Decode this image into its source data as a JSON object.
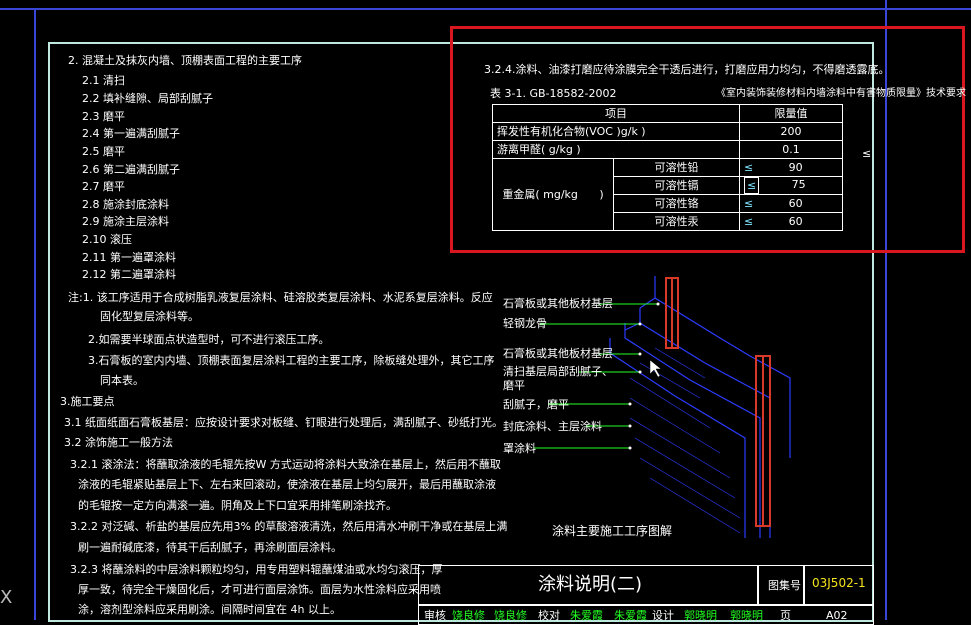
{
  "left_notes": {
    "section2_title": "2. 混凝土及抹灰内墙、顶棚表面工程的主要工序",
    "steps": [
      "2.1 清扫",
      "2.2 填补缝隙、局部刮腻子",
      "2.3 磨平",
      "2.4 第一遍满刮腻子",
      "2.5 磨平",
      "2.6 第二遍满刮腻子",
      "2.7 磨平",
      "2.8 施涂封底涂料",
      "2.9 施涂主层涂料",
      "2.10 滚压",
      "2.11 第一遍罩涂料",
      "2.12 第二遍罩涂料"
    ],
    "note1a": "注:1.  该工序适用于合成树脂乳液复层涂料、硅溶胶类复层涂料、水泥系复层涂料。反应",
    "note1b": "固化型复层涂料等。",
    "note2": "2.如需要半球面点状造型时，可不进行滚压工序。",
    "note3a": "3.石膏板的室内内墙、顶棚表面复层涂料工程的主要工序，除板缝处理外，其它工序",
    "note3b": "同本表。",
    "section3_title": "3.施工要点",
    "p31": "3.1 纸面纸面石膏板基层：应按设计要求对板缝、钉眼进行处理后，满刮腻子、砂纸打光。",
    "p32": "3.2 涂饰施工一般方法",
    "p321a": "3.2.1 滚涂法：将蘸取涂液的毛辊先按W   方式运动将涂料大致涂在基层上，然后用不蘸取",
    "p321b": "涂液的毛辊紧贴基层上下、左右来回滚动，使涂液在基层上均匀展开，最后用蘸取涂液",
    "p321c": "的毛辊按一定方向满滚一遍。阴角及上下口宜采用排笔刷涂找齐。",
    "p322a": "3.2.2 对泛碱、析盐的基层应先用3%     的草酸溶液清洗，然后用清水冲刷干净或在基层上满",
    "p322b": "刷一遍耐碱底漆，待其干后刮腻子，再涂刷面层涂料。",
    "p323a": "3.2.3 将蘸涂料的中层涂料颗粒均匀，用专用塑料辊蘸煤油或水均匀滚压，厚",
    "p323b": "厚一致，待完全干燥固化后，才可进行面层涂饰。面层为水性涂料应采用喷",
    "p323c": "涂，溶剂型涂料应采用刷涂。间隔时间宜在 4h      以上。"
  },
  "highlight_block": {
    "clause": "3.2.4.涂料、油漆打磨应待涂膜完全干透后进行，打磨应用力均匀，不得磨透露底。",
    "table_ref": "表 3-1. GB-18582-2002",
    "table_title": "《室内装饰装修材料内墙涂料中有害物质限量》技术要求",
    "col_item": "项目",
    "col_limit": "限量值",
    "rows": [
      {
        "item": "挥发性有机化合物(VOC      )g/k             )",
        "value": "200"
      },
      {
        "item": "游离甲醛(  g/kg              )",
        "value": "0.1"
      }
    ],
    "heavy_metal_label": "重金属( mg/kg",
    "heavy_metal_paren": ")",
    "metals": [
      {
        "name": "可溶性铅",
        "sym": "≤",
        "value": "90"
      },
      {
        "name": "可溶性镉",
        "sym": "≤",
        "value": "75"
      },
      {
        "name": "可溶性铬",
        "sym": "≤",
        "value": "60"
      },
      {
        "name": "可溶性汞",
        "sym": "≤",
        "value": "60"
      }
    ],
    "side_symbol": "≤"
  },
  "diagram": {
    "labels": [
      "石膏板或其他板材基层",
      "轻钢龙骨",
      "石膏板或其他板材基层",
      "清扫基层局部刮腻子、",
      "磨平",
      "刮腻子，磨平",
      "封底涂料、主层涂料",
      "罩涂料"
    ],
    "caption": "涂料主要施工工序图解"
  },
  "title_block": {
    "title": "涂料说明(二)",
    "atlas_label": "图集号",
    "atlas_no": "03J502-1",
    "page_label": "页",
    "page_no": "A02",
    "bottom_row": [
      "审核",
      "饶良修",
      "饶良修",
      "校对",
      "朱爱霞",
      "朱爱霞",
      "设计",
      "郭晓明",
      "郭晓明"
    ]
  },
  "left_edge_glyph": "X",
  "colors": {
    "background": "#000000",
    "frame": "#3a47d6",
    "highlight": "#d8171e",
    "sheet_border": "#bfe8df",
    "leader": "#22ff22",
    "stud": "#d83a2a",
    "wall_edge": "#2c3cff"
  }
}
